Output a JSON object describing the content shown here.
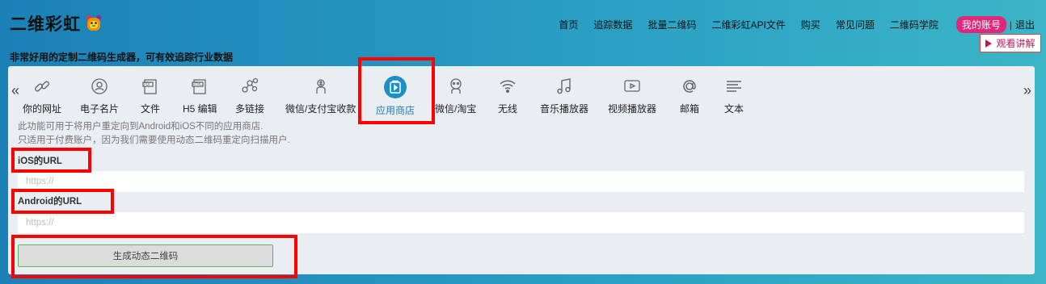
{
  "brand": {
    "title": "二维彩虹",
    "tagline": "非常好用的定制二维码生成器，可有效追踪行业数据"
  },
  "nav": {
    "links": [
      "首页",
      "追踪数据",
      "批量二维码",
      "二维彩虹API文件",
      "购买",
      "常见问题",
      "二维码学院"
    ],
    "account": "我的账号",
    "separator": "|",
    "logout": "退出"
  },
  "watch_button": "观看讲解",
  "tabs": [
    {
      "label": "你的网址",
      "icon": "link-icon"
    },
    {
      "label": "电子名片",
      "icon": "contact-card-icon"
    },
    {
      "label": "文件",
      "icon": "pdf-file-icon"
    },
    {
      "label": "H5 编辑",
      "icon": "html-file-icon"
    },
    {
      "label": "多链接",
      "icon": "multi-link-icon"
    },
    {
      "label": "微信/支付宝收款",
      "icon": "payment-icon"
    },
    {
      "label": "应用商店",
      "icon": "app-store-icon",
      "active": true
    },
    {
      "label": "微信/淘宝",
      "icon": "wechat-taobao-icon"
    },
    {
      "label": "无线",
      "icon": "wifi-icon"
    },
    {
      "label": "音乐播放器",
      "icon": "music-icon"
    },
    {
      "label": "视频播放器",
      "icon": "video-icon"
    },
    {
      "label": "邮箱",
      "icon": "at-icon"
    },
    {
      "label": "文本",
      "icon": "text-icon"
    }
  ],
  "arrows": {
    "prev": "«",
    "next": "»"
  },
  "description": {
    "line1": "此功能可用于将用户重定向到Android和iOS不同的应用商店.",
    "line2": "只适用于付费账户，因为我们需要使用动态二维码重定向扫描用户."
  },
  "ios_field": {
    "label": "iOS的URL",
    "placeholder": "https://",
    "value": ""
  },
  "android_field": {
    "label": "Android的URL",
    "placeholder": "https://",
    "value": ""
  },
  "generate_button": "生成动态二维码",
  "colors": {
    "accent": "#1e8fc2",
    "account_badge": "#e0277a",
    "highlight": "#ff0000",
    "button_border": "#5cb85c"
  }
}
